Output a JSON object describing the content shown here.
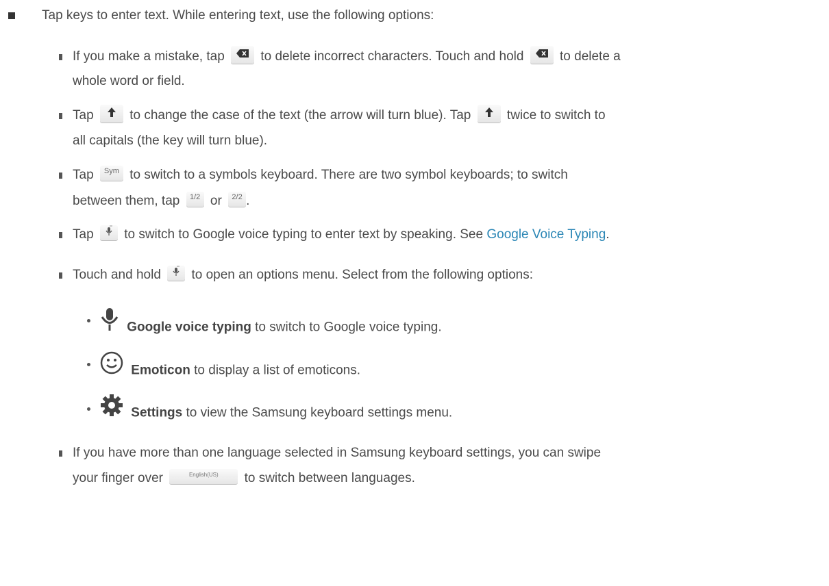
{
  "main_item": {
    "text": "Tap keys to enter text. While entering text, use the following options:"
  },
  "options": [
    {
      "l1_before": "If you make a mistake, tap",
      "l1_mid": "to delete incorrect characters. Touch and hold",
      "l1_after": "to delete a",
      "l2": "whole word or field."
    },
    {
      "l1_before": "Tap",
      "l1_mid": "to change the case of the text (the arrow will turn blue). Tap",
      "l1_after": "twice to switch to",
      "l2": "all capitals (the key will turn blue)."
    },
    {
      "l1_before": "Tap",
      "key_label": "Sym",
      "l1_after": "to switch to a symbols keyboard. There are two symbol keyboards; to switch",
      "l2_before": "between them, tap",
      "key_a": "1/2",
      "l2_mid": "or",
      "key_b": "2/2",
      "l2_after": "."
    },
    {
      "l1_before": "Tap",
      "l1_after": "to switch to Google voice typing to enter text by speaking. See",
      "link_text": "Google Voice Typing",
      "l1_end": "."
    },
    {
      "l1_before": "Touch and hold",
      "l1_after": "to open an options menu. Select from the following options:"
    }
  ],
  "sub_options": [
    {
      "icon": "microphone-icon",
      "bold": "Google voice typing",
      "text": "to switch to Google voice typing."
    },
    {
      "icon": "smiley-icon",
      "bold": "Emoticon",
      "text": "to display a list of emoticons."
    },
    {
      "icon": "gear-icon",
      "bold": "Settings",
      "text": "to view the Samsung keyboard settings menu."
    }
  ],
  "last_option": {
    "l1": "If you have more than one language selected in Samsung keyboard settings, you can swipe",
    "l2_before": "your finger over",
    "key_label": "English(US)",
    "l2_after": "to switch between languages."
  }
}
